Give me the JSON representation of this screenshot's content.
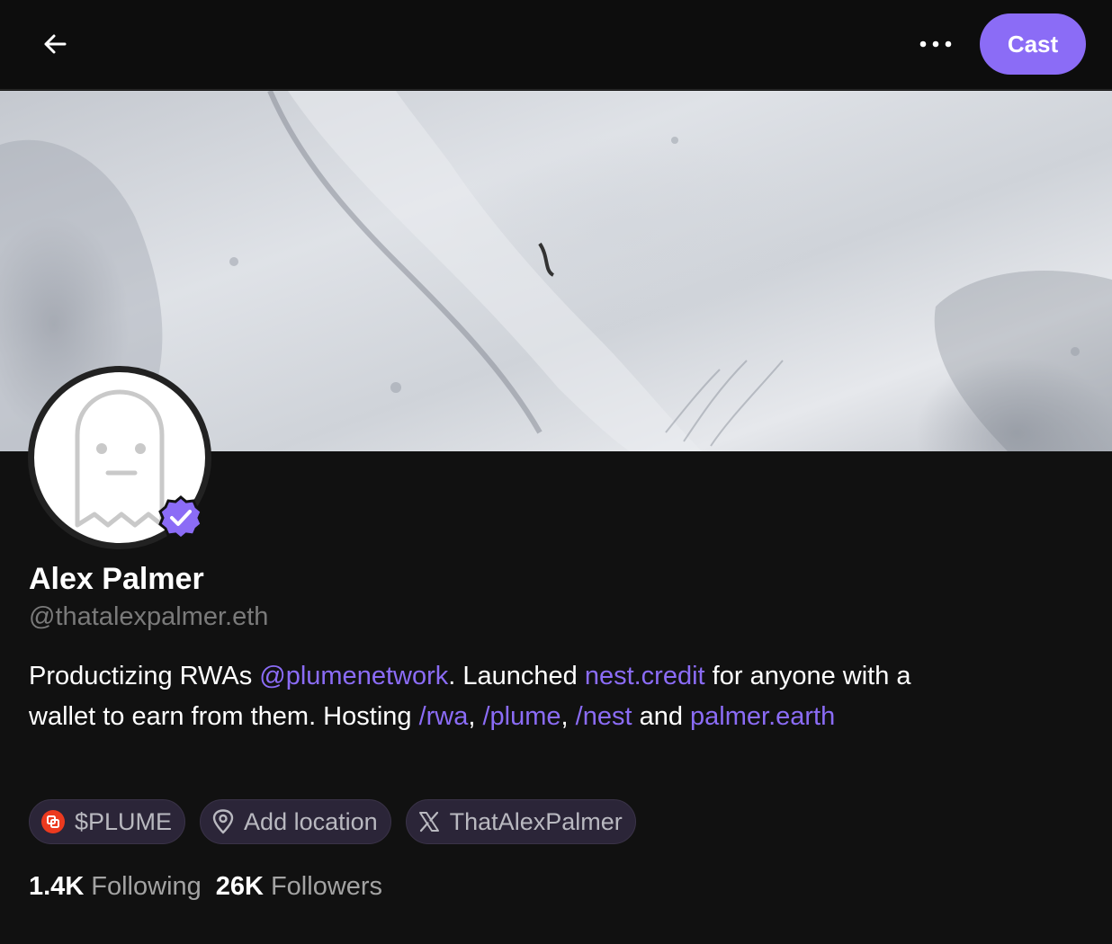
{
  "header": {
    "back_icon": "arrow-left-icon",
    "more_icon": "ellipsis-icon",
    "cast_label": "Cast",
    "accent_color": "#8b6cf6"
  },
  "banner": {
    "image": "gray terrain landscape banner"
  },
  "profile": {
    "avatar_icon": "ghost-avatar",
    "verified_icon": "verified-badge-icon",
    "display_name": "Alex Palmer",
    "username": "@thatalexpalmer.eth",
    "bio": [
      {
        "text": "Productizing RWAs ",
        "link": false
      },
      {
        "text": "@plumenetwork",
        "link": true
      },
      {
        "text": ". Launched ",
        "link": false
      },
      {
        "text": "nest.credit",
        "link": true
      },
      {
        "text": " for anyone with a wallet to earn from them. Hosting ",
        "link": false
      },
      {
        "text": "/rwa",
        "link": true
      },
      {
        "text": ", ",
        "link": false
      },
      {
        "text": "/plume",
        "link": true
      },
      {
        "text": ", ",
        "link": false
      },
      {
        "text": "/nest",
        "link": true
      },
      {
        "text": " and ",
        "link": false
      },
      {
        "text": "palmer.earth",
        "link": true
      }
    ],
    "chips": [
      {
        "label": "$PLUME",
        "icon": "plume-token-icon"
      },
      {
        "label": "Add location",
        "icon": "location-pin-icon"
      },
      {
        "label": "ThatAlexPalmer",
        "icon": "x-logo-icon"
      }
    ],
    "stats": {
      "following_count": "1.4K",
      "following_label": "Following",
      "followers_count": "26K",
      "followers_label": "Followers"
    }
  }
}
